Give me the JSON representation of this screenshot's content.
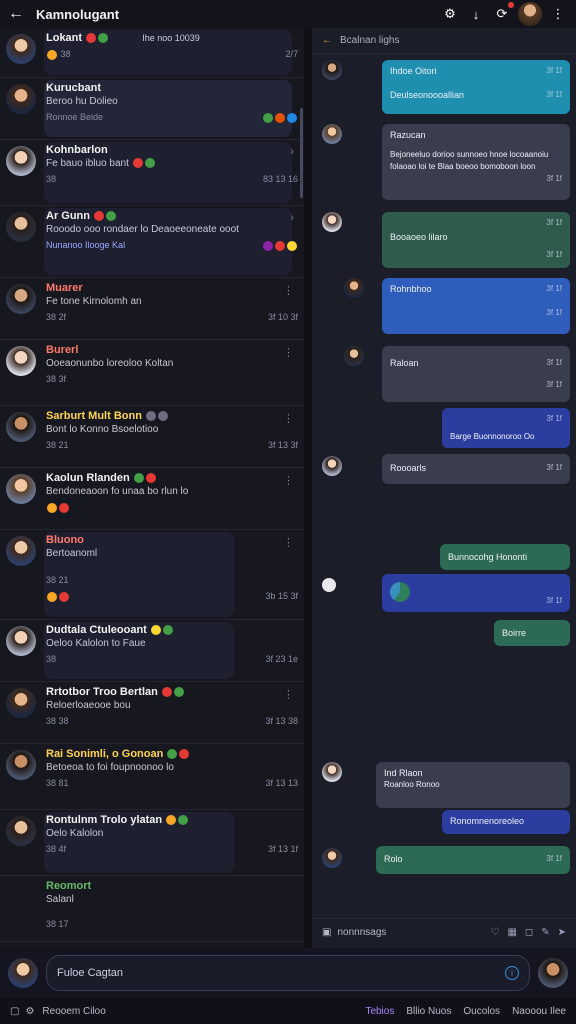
{
  "topbar": {
    "title": "Kamnolugant"
  },
  "left_chats": [
    {
      "name": "Lokant",
      "msg": "",
      "time": "2/7",
      "meta": "38",
      "preview_top": "Ihe noo 10039"
    },
    {
      "name": "Kurucbant",
      "msg": "Beroo hu Dolieo",
      "time": "",
      "meta": "Ronnoe Beide"
    },
    {
      "name": "Kohnbarlon",
      "msg": "Fe bauo ibluo bant",
      "time": "83 13 16",
      "meta": "38"
    },
    {
      "name": "Ar Gunn",
      "msg": "Rooodo ooo rondaer lo Deaoeeoneate ooot",
      "time": "",
      "meta": "Nunanoo Ilooge Kal"
    },
    {
      "name": "Muarer",
      "msg": "Fe tone Kirnolomh an",
      "time": "3f 10 3f",
      "meta": "38 2f"
    },
    {
      "name": "Burerl",
      "msg": "Ooeaonunbo loreoloo Koltan",
      "time": "",
      "meta": "38 3f"
    },
    {
      "name": "Sarburt Mult Bonn",
      "msg": "Bont lo Konno Bsoelotioo",
      "time": "3f 13 3f",
      "meta": "38 21"
    },
    {
      "name": "Kaolun Rlanden",
      "msg": "Bendoneaoon fo unaa bo rlun lo",
      "time": "",
      "meta": ""
    },
    {
      "name": "Bluono",
      "msg": "Bertoanoml",
      "time": "3b 15 3f",
      "meta": "38 21"
    },
    {
      "name": "Dudtala Ctuleooant",
      "msg": "Oeloo Kalolon to Faue",
      "time": "3f 23 1e",
      "meta": "38"
    },
    {
      "name": "Rrtotbor Troo Bertlan",
      "msg": "Reloerloaeooe bou",
      "time": "3f 13 38",
      "meta": "38 38"
    },
    {
      "name": "Rai Sonimli, o Gonoan",
      "msg": "Betoeoa to foi foupnoonoo lo",
      "time": "3f 13 13",
      "meta": "38 81"
    },
    {
      "name": "Rontulnm Trolo ylatan",
      "msg": "Oelo Kalolon",
      "time": "3f 13 1f",
      "meta": "38 4f"
    },
    {
      "name": "Reomort",
      "msg": "Salanl",
      "time": "",
      "meta": "38 17"
    }
  ],
  "conv": {
    "header": "Bcalnan lighs",
    "bubbles": [
      {
        "title": "Ihdoe Oitori",
        "sub": "Deulseonoooallian",
        "time": "3f 1f",
        "time2": "3f 1f"
      },
      {
        "title": "Razucan",
        "sub": "Bejoneeluo dorioo sunnoeo hnoe locoaanoiu folaoao loi te Blaa boeoo bomoboon loon",
        "time": "3f 1f"
      },
      {
        "title": "Booaoeo lilaro",
        "sub": "",
        "time": "3f 1f",
        "time2": "3f 1f"
      },
      {
        "title": "Rohnbhoo",
        "sub": "",
        "time": "3f 1f",
        "time2": "3f 1f"
      },
      {
        "title": "Raloan",
        "sub": "",
        "time": "3f 1f",
        "time2": "3f 1f"
      },
      {
        "title": "Barge Buonnonoroo Oo",
        "sub": "",
        "time": "3f 1f"
      },
      {
        "title": "Roooarls",
        "sub": "",
        "time": "3f 1f"
      },
      {
        "title": "Bunnocohg Hononti",
        "sub": "",
        "time": ""
      },
      {
        "title": "",
        "sub": "",
        "time": "3f 1f"
      },
      {
        "title": "Boirre",
        "sub": "",
        "time": ""
      },
      {
        "title": "Ind Rlaon",
        "sub": "Roanloo Ronoo",
        "time": "3f 1f"
      },
      {
        "title": "Ronomnenoreoleo",
        "sub": "",
        "time": ""
      },
      {
        "title": "Rolo",
        "sub": "",
        "time": "3f 1f"
      }
    ],
    "composer_label": "nonnnsags"
  },
  "input": {
    "placeholder": "Fuloe Cagtan"
  },
  "bottombar": {
    "left": "Reooem Ciloo",
    "tabs": [
      "Tebios",
      "Bllio Nuos",
      "Oucolos",
      "Naooou Ilee"
    ]
  }
}
